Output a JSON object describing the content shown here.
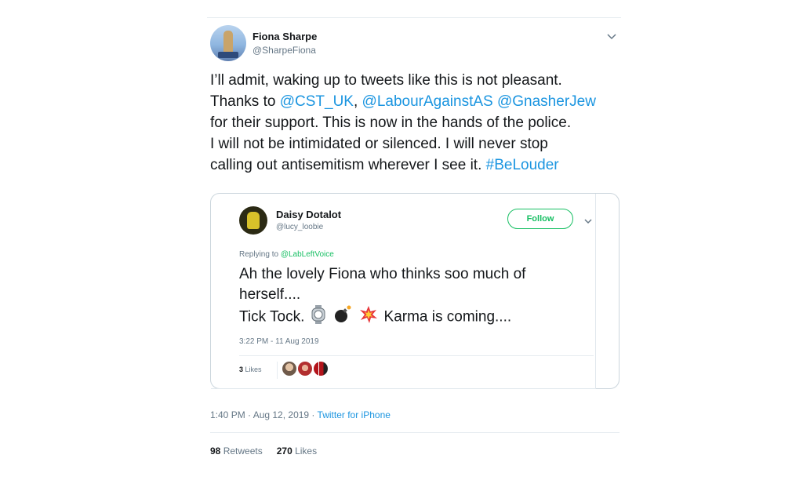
{
  "tweet": {
    "author_name": "Fiona Sharpe",
    "author_handle": "@SharpeFiona",
    "body": {
      "line1": "I’ll admit, waking up to tweets like this is not pleasant.",
      "line2_prefix": "Thanks to ",
      "mention1": "@CST_UK",
      "sep1": ", ",
      "mention2": "@LabourAgainstAS",
      "sep2": " ",
      "mention3": "@GnasherJew",
      "line3": "for their support. This is now in the hands of the police.",
      "line4": "I will not be intimidated or silenced. I will never stop",
      "line5_prefix": "calling out antisemitism wherever I see it. ",
      "hashtag": "#BeLouder"
    },
    "timestamp": "1:40 PM · Aug 12, 2019 · ",
    "source": "Twitter for iPhone",
    "retweets_count": "98",
    "retweets_label": " Retweets",
    "likes_count": "270",
    "likes_label": " Likes"
  },
  "quoted": {
    "author_name": "Daisy Dotalot",
    "author_handle": "@lucy_loobie",
    "follow_label": "Follow",
    "replying_prefix": "Replying to ",
    "replying_to": "@LabLeftVoice",
    "line1": "Ah the lovely Fiona who thinks soo much of",
    "line2": "herself....",
    "line3_prefix": "Tick Tock.",
    "line3_suffix": "Karma is coming....",
    "emojis": [
      "watch-emoji",
      "bomb-emoji",
      "collision-emoji"
    ],
    "timestamp": "3:22 PM - 11 Aug 2019",
    "likes_count": "3",
    "likes_label": " Likes"
  },
  "colors": {
    "link": "#1b95e0",
    "follow_green": "#17bf63",
    "secondary_text": "#657786",
    "border": "#ccd6dd"
  }
}
